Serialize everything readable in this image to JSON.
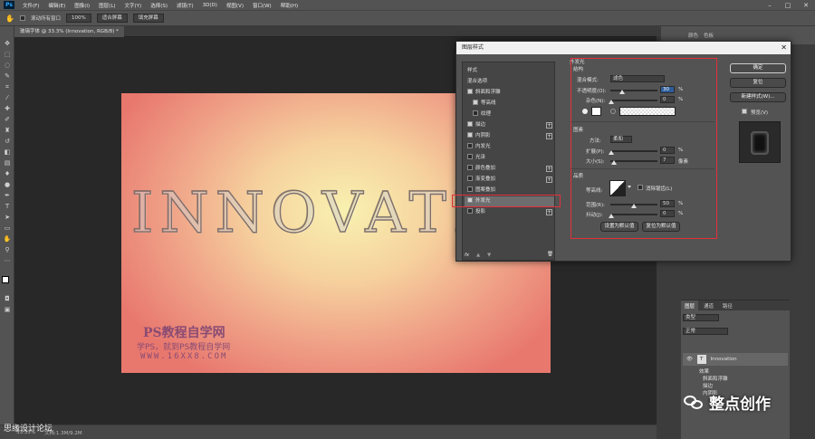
{
  "menubar": {
    "logo": "Ps",
    "items": [
      "文件(F)",
      "编辑(E)",
      "图像(I)",
      "图层(L)",
      "文字(Y)",
      "选择(S)",
      "滤镜(T)",
      "3D(D)",
      "视图(V)",
      "窗口(W)",
      "帮助(H)"
    ]
  },
  "options": {
    "scroll_all": "滚动所有窗口",
    "zoom": "100%",
    "fit_screen": "适合屏幕",
    "fill_screen": "填充屏幕"
  },
  "document": {
    "tab": "玻璃字体 @ 33.3% (Innovation, RGB/8) *",
    "text": "INNOVATIO",
    "watermark1": "PS教程自学网",
    "watermark2": "学PS，就到PS教程自学网",
    "watermark3": "WWW.16XX8.COM"
  },
  "status": {
    "zoom": "33.33%",
    "doc": "文档:1.3M/9.2M"
  },
  "bottom_watermark": "思缘设计论坛",
  "right_dock": {
    "top_tabs": [
      "颜色",
      "色板"
    ],
    "layers_tabs": [
      "图层",
      "通道",
      "路径"
    ],
    "kind": "类型",
    "blend": "正常",
    "layer_name": "Innovation",
    "effects_label": "效果",
    "effects": [
      "斜面和浮雕",
      "描边",
      "内阴影"
    ]
  },
  "dialog": {
    "title": "图层样式",
    "list": [
      {
        "label": "样式",
        "check": false,
        "has_check": false,
        "plus": false
      },
      {
        "label": "混合选项",
        "check": false,
        "has_check": false,
        "plus": false
      },
      {
        "label": "斜面和浮雕",
        "check": true,
        "has_check": true,
        "plus": false
      },
      {
        "label": "等高线",
        "check": true,
        "has_check": true,
        "plus": false,
        "indent": true
      },
      {
        "label": "纹理",
        "check": false,
        "has_check": true,
        "plus": false,
        "indent": true
      },
      {
        "label": "描边",
        "check": true,
        "has_check": true,
        "plus": true
      },
      {
        "label": "内阴影",
        "check": true,
        "has_check": true,
        "plus": true
      },
      {
        "label": "内发光",
        "check": false,
        "has_check": true,
        "plus": false
      },
      {
        "label": "光泽",
        "check": false,
        "has_check": true,
        "plus": false
      },
      {
        "label": "颜色叠加",
        "check": false,
        "has_check": true,
        "plus": true
      },
      {
        "label": "渐变叠加",
        "check": false,
        "has_check": true,
        "plus": true
      },
      {
        "label": "图案叠加",
        "check": false,
        "has_check": true,
        "plus": false
      },
      {
        "label": "外发光",
        "check": true,
        "has_check": true,
        "plus": false,
        "selected": true
      },
      {
        "label": "投影",
        "check": false,
        "has_check": true,
        "plus": true
      }
    ],
    "section_title": "外发光",
    "structure": "结构",
    "blend_mode_label": "混合模式:",
    "blend_mode_value": "滤色",
    "opacity_label": "不透明度(O):",
    "opacity_value": "30",
    "noise_label": "杂色(N):",
    "noise_value": "0",
    "pct": "%",
    "elements": "图素",
    "method_label": "方法:",
    "method_value": "柔和",
    "spread_label": "扩展(P):",
    "spread_value": "0",
    "size_label": "大小(S):",
    "size_value": "7",
    "px": "像素",
    "quality": "品质",
    "contour_label": "等高线:",
    "antialias": "消除锯齿(L)",
    "range_label": "范围(R):",
    "range_value": "50",
    "jitter_label": "抖动(J):",
    "jitter_value": "0",
    "set_default": "设置为默认值",
    "reset_default": "复位为默认值",
    "ok": "确定",
    "reset": "复位",
    "new_style": "新建样式(W)...",
    "preview": "预览(V)",
    "fx": "fx"
  },
  "wechat": "整点创作",
  "colors": {
    "highlight_box": "#e3303b"
  }
}
